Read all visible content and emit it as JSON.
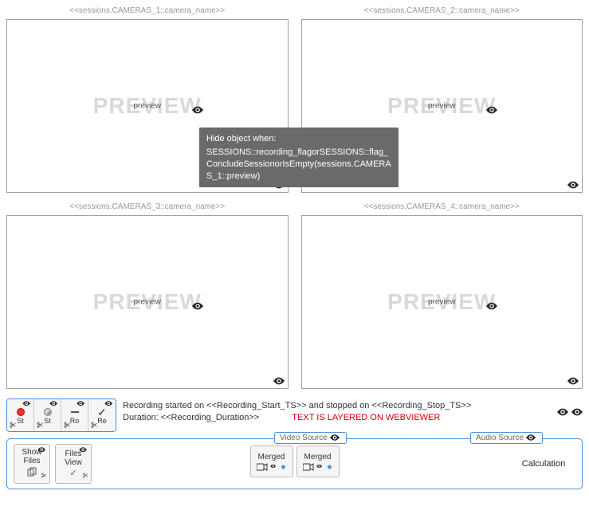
{
  "cameras": [
    {
      "label": "<<sessions.CAMERAS_1::camera_name>>",
      "preview": "PREVIEW",
      "field": "preview"
    },
    {
      "label": "<<sessions.CAMERAS_2::camera_name>>",
      "preview": "PREVIEW",
      "field": "preview"
    },
    {
      "label": "<<sessions.CAMERAS_3::camera_name>>",
      "preview": "PREVIEW",
      "field": "preview"
    },
    {
      "label": "<<sessions.CAMERAS_4::camera_name>>",
      "preview": "PREVIEW",
      "field": "preview"
    }
  ],
  "tooltip": {
    "title": "Hide object when:",
    "body": "SESSIONS::recording_flagorSESSIONS::flag_ConcludeSessionorIsEmpty(sessions.CAMERAS_1::preview)"
  },
  "controls": {
    "buttons": [
      {
        "name": "record-start",
        "label": "St"
      },
      {
        "name": "record-stop",
        "label": "St"
      },
      {
        "name": "record-pause",
        "label": "Ro"
      },
      {
        "name": "record-done",
        "label": "Re"
      }
    ]
  },
  "status": {
    "line1": "Recording started on <<Recording_Start_TS>> and stopped on <<Recording_Stop_TS>>",
    "duration_label": "Duration:",
    "duration_value": "<<Recording_Duration>>",
    "overlay_warning": "TEXT IS LAYERED ON WEBVIEWER"
  },
  "source_tabs": {
    "video": "Video Source",
    "audio": "Audio Source"
  },
  "bottom": {
    "show_files": "Show Files",
    "files_view": "Files View",
    "merged": "Merged",
    "calculation": "Calculation"
  }
}
